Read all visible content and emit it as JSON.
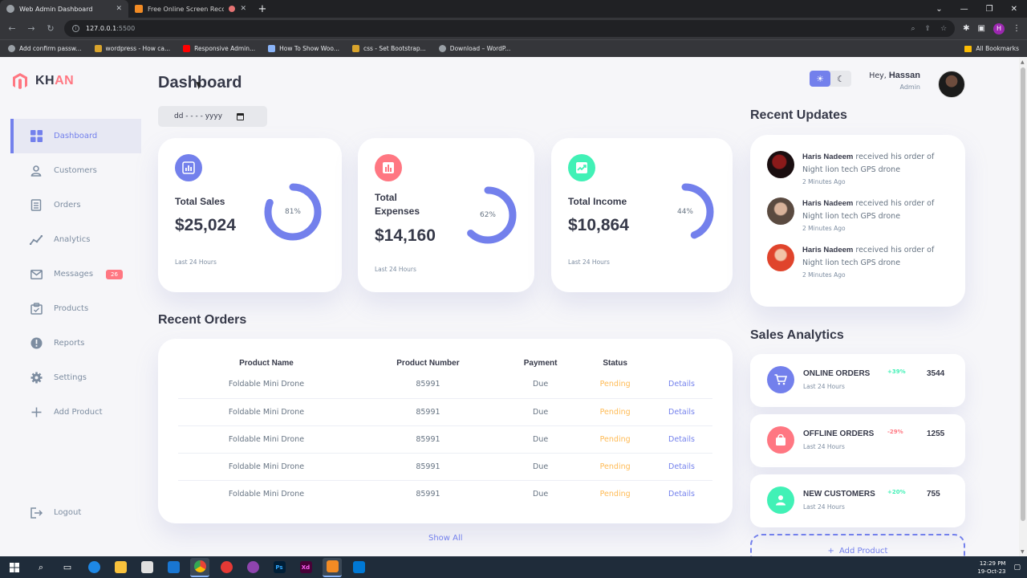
{
  "browser": {
    "tabs": [
      {
        "title": "Web Admin Dashboard",
        "active": true
      },
      {
        "title": "Free Online Screen Recorde",
        "active": false
      }
    ],
    "url_host": "127.0.0.1",
    "url_port": ":5500",
    "bookmarks": [
      "Add confirm passw...",
      "wordpress - How ca...",
      "Responsive Admin...",
      "How To Show Woo...",
      "css - Set Bootstrap...",
      "Download – WordP..."
    ],
    "all_bookmarks": "All Bookmarks",
    "profile_initial": "H"
  },
  "brand": {
    "part1": "KH",
    "part2": "AN",
    "accent": "#ff7782",
    "primary": "#7380ec"
  },
  "sidebar": {
    "items": [
      {
        "label": "Dashboard",
        "icon": "grid-icon",
        "active": true
      },
      {
        "label": "Customers",
        "icon": "person-icon"
      },
      {
        "label": "Orders",
        "icon": "receipt-icon"
      },
      {
        "label": "Analytics",
        "icon": "insights-icon"
      },
      {
        "label": "Messages",
        "icon": "mail-icon",
        "badge": "26"
      },
      {
        "label": "Products",
        "icon": "inventory-icon"
      },
      {
        "label": "Reports",
        "icon": "report-icon"
      },
      {
        "label": "Settings",
        "icon": "settings-icon"
      },
      {
        "label": "Add Product",
        "icon": "add-icon"
      }
    ],
    "logout": "Logout"
  },
  "header": {
    "title": "Dashboard",
    "date_placeholder": "dd - - - - yyyy",
    "greeting": "Hey,",
    "user_name": "Hassan",
    "role": "Admin"
  },
  "stats": [
    {
      "label": "Total Sales",
      "value": "$25,024",
      "percent_text": "81%",
      "percent": 81,
      "note": "Last 24 Hours",
      "color": "#7380ec"
    },
    {
      "label": "Total Expenses",
      "value": "$14,160",
      "percent_text": "62%",
      "percent": 62,
      "note": "Last 24 Hours",
      "color": "#ff7782"
    },
    {
      "label": "Total Income",
      "value": "$10,864",
      "percent_text": "44%",
      "percent": 44,
      "note": "Last 24 Hours",
      "color": "#41f1b6"
    }
  ],
  "orders": {
    "title": "Recent Orders",
    "columns": [
      "Product Name",
      "Product Number",
      "Payment",
      "Status"
    ],
    "rows": [
      {
        "name": "Foldable Mini Drone",
        "number": "85991",
        "payment": "Due",
        "status": "Pending",
        "action": "Details"
      },
      {
        "name": "Foldable Mini Drone",
        "number": "85991",
        "payment": "Due",
        "status": "Pending",
        "action": "Details"
      },
      {
        "name": "Foldable Mini Drone",
        "number": "85991",
        "payment": "Due",
        "status": "Pending",
        "action": "Details"
      },
      {
        "name": "Foldable Mini Drone",
        "number": "85991",
        "payment": "Due",
        "status": "Pending",
        "action": "Details"
      },
      {
        "name": "Foldable Mini Drone",
        "number": "85991",
        "payment": "Due",
        "status": "Pending",
        "action": "Details"
      }
    ],
    "show_all": "Show All"
  },
  "updates": {
    "title": "Recent Updates",
    "items": [
      {
        "name": "Haris Nadeem",
        "text": " received his order of Night lion tech GPS drone",
        "time": "2 Minutes Ago"
      },
      {
        "name": "Haris Nadeem",
        "text": " received his order of Night lion tech GPS drone",
        "time": "2 Minutes Ago"
      },
      {
        "name": "Haris Nadeem",
        "text": " received his order of Night lion tech GPS drone",
        "time": "2 Minutes Ago"
      }
    ]
  },
  "analytics": {
    "title": "Sales Analytics",
    "items": [
      {
        "title": "ONLINE ORDERS",
        "sub": "Last 24 Hours",
        "pct": "+39%",
        "value": "3544",
        "color": "#7380ec"
      },
      {
        "title": "OFFLINE ORDERS",
        "sub": "Last 24 Hours",
        "pct": "-29%",
        "value": "1255",
        "color": "#ff7782"
      },
      {
        "title": "NEW CUSTOMERS",
        "sub": "Last 24 Hours",
        "pct": "+20%",
        "value": "755",
        "color": "#41f1b6"
      }
    ],
    "add_product": "Add Product"
  },
  "taskbar": {
    "time": "12:29 PM",
    "date": "19-Oct-23"
  }
}
